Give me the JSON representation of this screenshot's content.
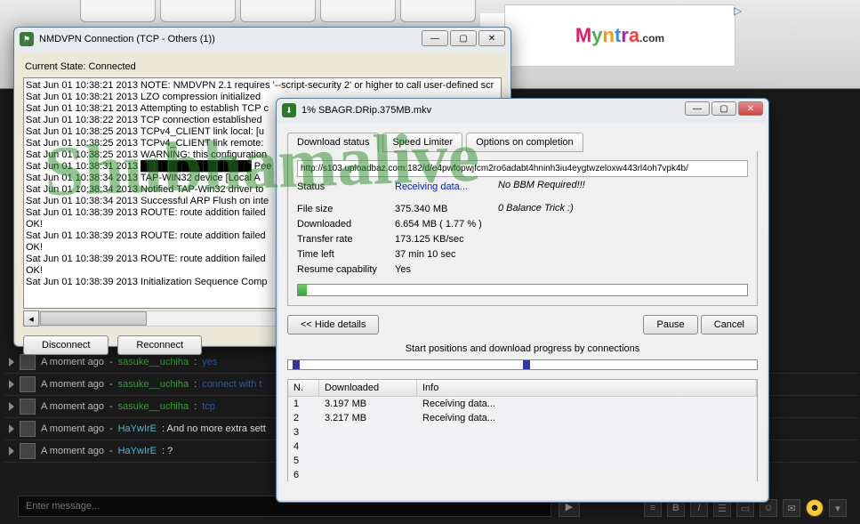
{
  "bg": {
    "myntra": "Myntra",
    "com": ".com",
    "adchoice": "▷"
  },
  "chat": {
    "lines": [
      {
        "time": "A moment ago",
        "user": "sasuke__uchiha",
        "ucls": "c1",
        "msg": "yes",
        "mcls": "msg"
      },
      {
        "time": "A moment ago",
        "user": "sasuke__uchiha",
        "ucls": "c1",
        "msg": "connect with t",
        "mcls": "msg"
      },
      {
        "time": "A moment ago",
        "user": "sasuke__uchiha",
        "ucls": "c1",
        "msg": "tcp",
        "mcls": "msg"
      },
      {
        "time": "A moment ago",
        "user": "HaYwIrE",
        "ucls": "c2",
        "msg": ": And no more extra sett",
        "mcls": "msg2"
      },
      {
        "time": "A moment ago",
        "user": "HaYwIrE",
        "ucls": "c2",
        "msg": ": ?",
        "mcls": "msg2"
      }
    ],
    "placeholder": "Enter message...",
    "send": "▶"
  },
  "vpn": {
    "title": "NMDVPN Connection (TCP - Others (1))",
    "state_label": "Current State: Connected",
    "log": [
      "Sat Jun 01 10:38:21 2013 NOTE: NMDVPN 2.1 requires '--script-security 2' or higher to call user-defined scr",
      "Sat Jun 01 10:38:21 2013 LZO compression initialized",
      "Sat Jun 01 10:38:21 2013 Attempting to establish TCP c",
      "Sat Jun 01 10:38:22 2013 TCP connection established",
      "Sat Jun 01 10:38:25 2013 TCPv4_CLIENT link local: [u",
      "Sat Jun 01 10:38:25 2013 TCPv4_CLIENT link remote:",
      "Sat Jun 01 10:38:25 2013 WARNING: this configuration",
      "Sat Jun 01 10:38:31 2013 ████████████████ Pee",
      "Sat Jun 01 10:38:34 2013 TAP-WIN32 device [Local A",
      "Sat Jun 01 10:38:34 2013 Notified TAP-Win32 driver to",
      "Sat Jun 01 10:38:34 2013 Successful ARP Flush on inte",
      "Sat Jun 01 10:38:39 2013 ROUTE: route addition failed",
      "OK!",
      "Sat Jun 01 10:38:39 2013 ROUTE: route addition failed",
      "OK!",
      "Sat Jun 01 10:38:39 2013 ROUTE: route addition failed",
      "OK!",
      "Sat Jun 01 10:38:39 2013 Initialization Sequence Comp"
    ],
    "disconnect": "Disconnect",
    "reconnect": "Reconnect"
  },
  "idm": {
    "title": "1% SBAGR.DRip.375MB.mkv",
    "tabs": {
      "status": "Download status",
      "speed": "Speed Limiter",
      "options": "Options on completion"
    },
    "url": "http://s103.uploadbaz.com:182/d/e4pwfopwjfcm2ro6adabt4hninh3iu4eygtwzeloxw443rl4oh7vpk4b/",
    "status_label": "Status",
    "status_value": "Receiving data...",
    "filesize_label": "File size",
    "filesize_value": "375.340  MB",
    "downloaded_label": "Downloaded",
    "downloaded_value": "6.654  MB  ( 1.77 % )",
    "rate_label": "Transfer rate",
    "rate_value": "173.125  KB/sec",
    "time_label": "Time left",
    "time_value": "37 min 10 sec",
    "resume_label": "Resume capability",
    "resume_value": "Yes",
    "hide": "<< Hide details",
    "pause": "Pause",
    "cancel": "Cancel",
    "startpos": "Start positions and download progress by connections",
    "cols": {
      "n": "N.",
      "dl": "Downloaded",
      "info": "Info"
    },
    "rows": [
      {
        "n": "1",
        "dl": "3.197  MB",
        "info": "Receiving data..."
      },
      {
        "n": "2",
        "dl": "3.217  MB",
        "info": "Receiving data..."
      },
      {
        "n": "3",
        "dl": "",
        "info": ""
      },
      {
        "n": "4",
        "dl": "",
        "info": ""
      },
      {
        "n": "5",
        "dl": "",
        "info": ""
      },
      {
        "n": "6",
        "dl": "",
        "info": ""
      }
    ]
  },
  "overlay": {
    "l1": "No BBM Required!!!",
    "l2": "0 Balance Trick :)"
  },
  "watermark": "Shubhamalive"
}
